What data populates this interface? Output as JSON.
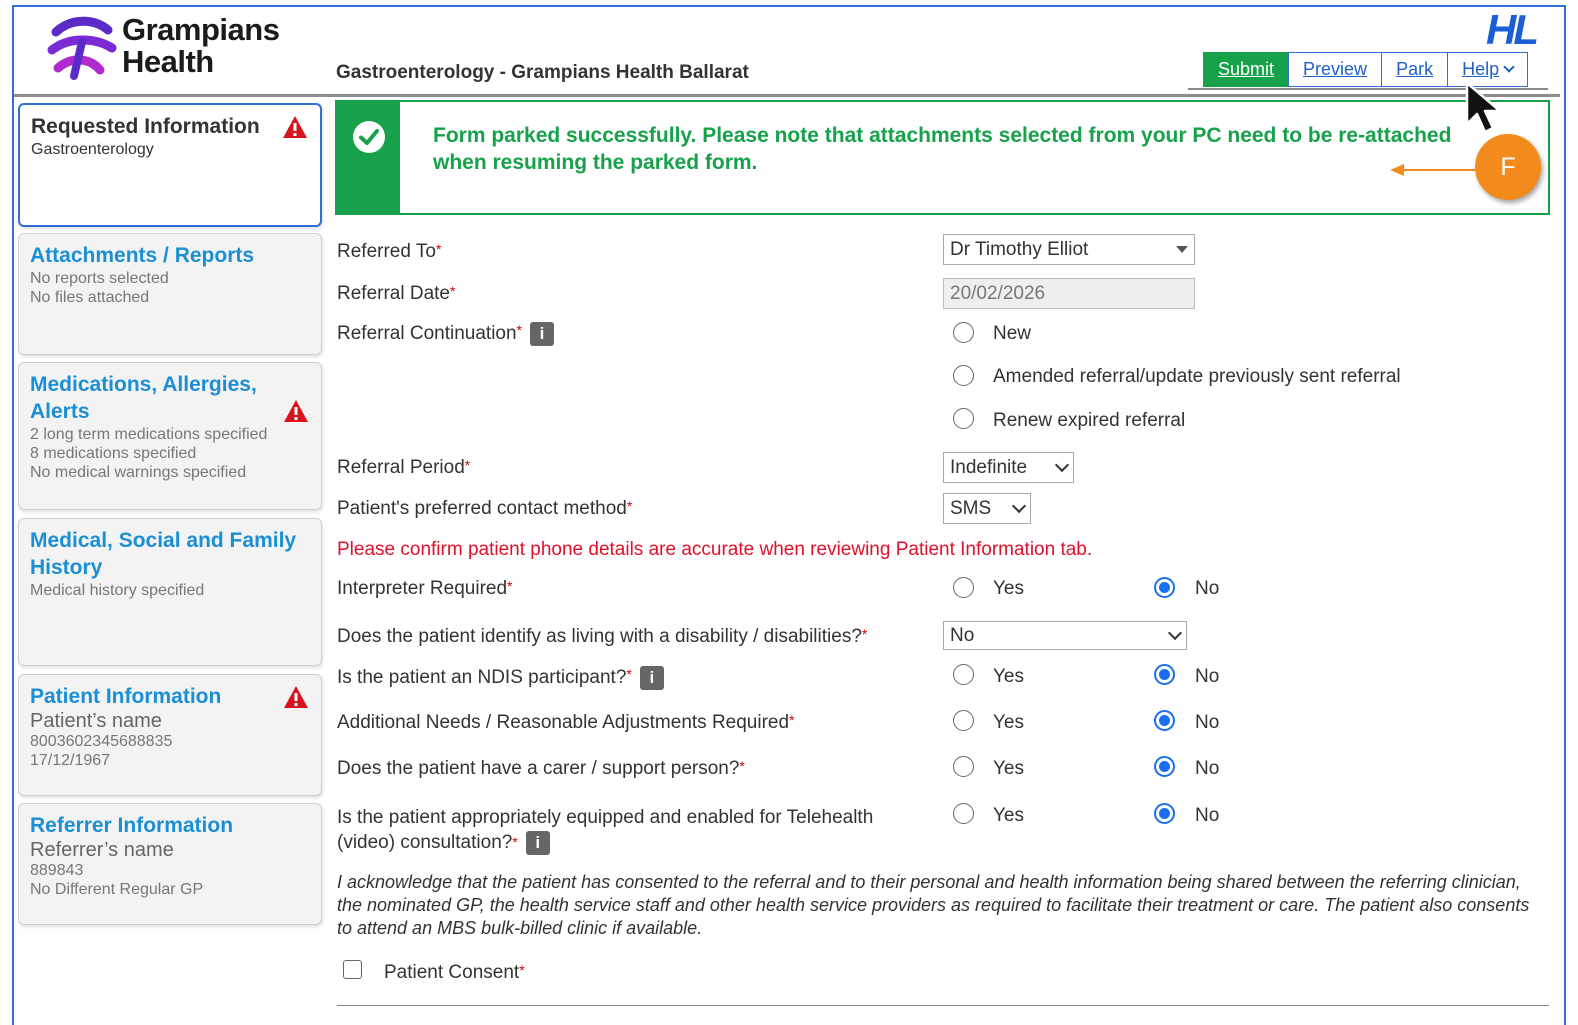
{
  "header": {
    "org_line1": "Grampians",
    "org_line2": "Health",
    "app_title": "Gastroenterology - Grampians Health Ballarat",
    "hl_logo": "HL",
    "toolbar": {
      "submit": "Submit",
      "preview": "Preview",
      "park": "Park",
      "help": "Help"
    }
  },
  "banner": {
    "message": "Form parked successfully. Please note that attachments selected from your PC need to be re-attached when resuming the parked form."
  },
  "annotation": {
    "label": "F"
  },
  "sidebar": {
    "items": [
      {
        "title": "Requested Information",
        "lines": [
          "Gastroenterology"
        ]
      },
      {
        "title": "Attachments / Reports",
        "lines": [
          "No reports selected",
          "No files attached"
        ]
      },
      {
        "title": "Medications, Allergies, Alerts",
        "lines": [
          "2 long term medications specified",
          "8 medications specified",
          "No medical warnings specified"
        ]
      },
      {
        "title": "Medical, Social and Family History",
        "lines": [
          "Medical history specified"
        ]
      },
      {
        "title": "Patient Information",
        "name": "Patient’s name",
        "lines": [
          "8003602345688835",
          "17/12/1967"
        ]
      },
      {
        "title": "Referrer Information",
        "name": "Referrer’s name",
        "lines": [
          "889843",
          "No Different Regular GP"
        ]
      }
    ]
  },
  "form": {
    "referred_to": {
      "label": "Referred To",
      "value": "Dr Timothy Elliot"
    },
    "referral_date": {
      "label": "Referral Date",
      "value": "20/02/2026"
    },
    "referral_continuation": {
      "label": "Referral Continuation",
      "options": [
        "New",
        "Amended referral/update previously sent referral",
        "Renew expired referral"
      ]
    },
    "referral_period": {
      "label": "Referral Period",
      "value": "Indefinite"
    },
    "contact_method": {
      "label": "Patient's preferred contact method",
      "value": "SMS"
    },
    "phone_notice": "Please confirm patient phone details are accurate when reviewing Patient Information tab.",
    "interpreter": {
      "label": "Interpreter Required",
      "selected": "No"
    },
    "disability": {
      "label": "Does the patient identify as living with a disability / disabilities?",
      "value": "No"
    },
    "ndis": {
      "label": "Is the patient an NDIS participant?",
      "selected": "No"
    },
    "additional_needs": {
      "label": "Additional Needs / Reasonable Adjustments Required",
      "selected": "No"
    },
    "carer": {
      "label": "Does the patient have a carer / support person?",
      "selected": "No"
    },
    "telehealth": {
      "label_line1": "Is the patient appropriately equipped and enabled for Telehealth",
      "label_line2": "(video) consultation?",
      "selected": "No"
    },
    "yes_label": "Yes",
    "no_label": "No",
    "acknowledgement": "I acknowledge that the patient has consented to the referral and to their personal and health information being shared between the referring clinician, the nominated GP, the health service staff and other health service providers as required to facilitate their treatment or care. The patient also consents to attend an MBS bulk-billed clinic if available.",
    "consent_label": "Patient Consent",
    "required_mark": "*"
  },
  "colors": {
    "brand_purple": "#6a2bd6",
    "success_green": "#16a14a",
    "link_blue": "#1a8fd6",
    "warning_red": "#e0102a",
    "callout_orange": "#f28b1c"
  }
}
